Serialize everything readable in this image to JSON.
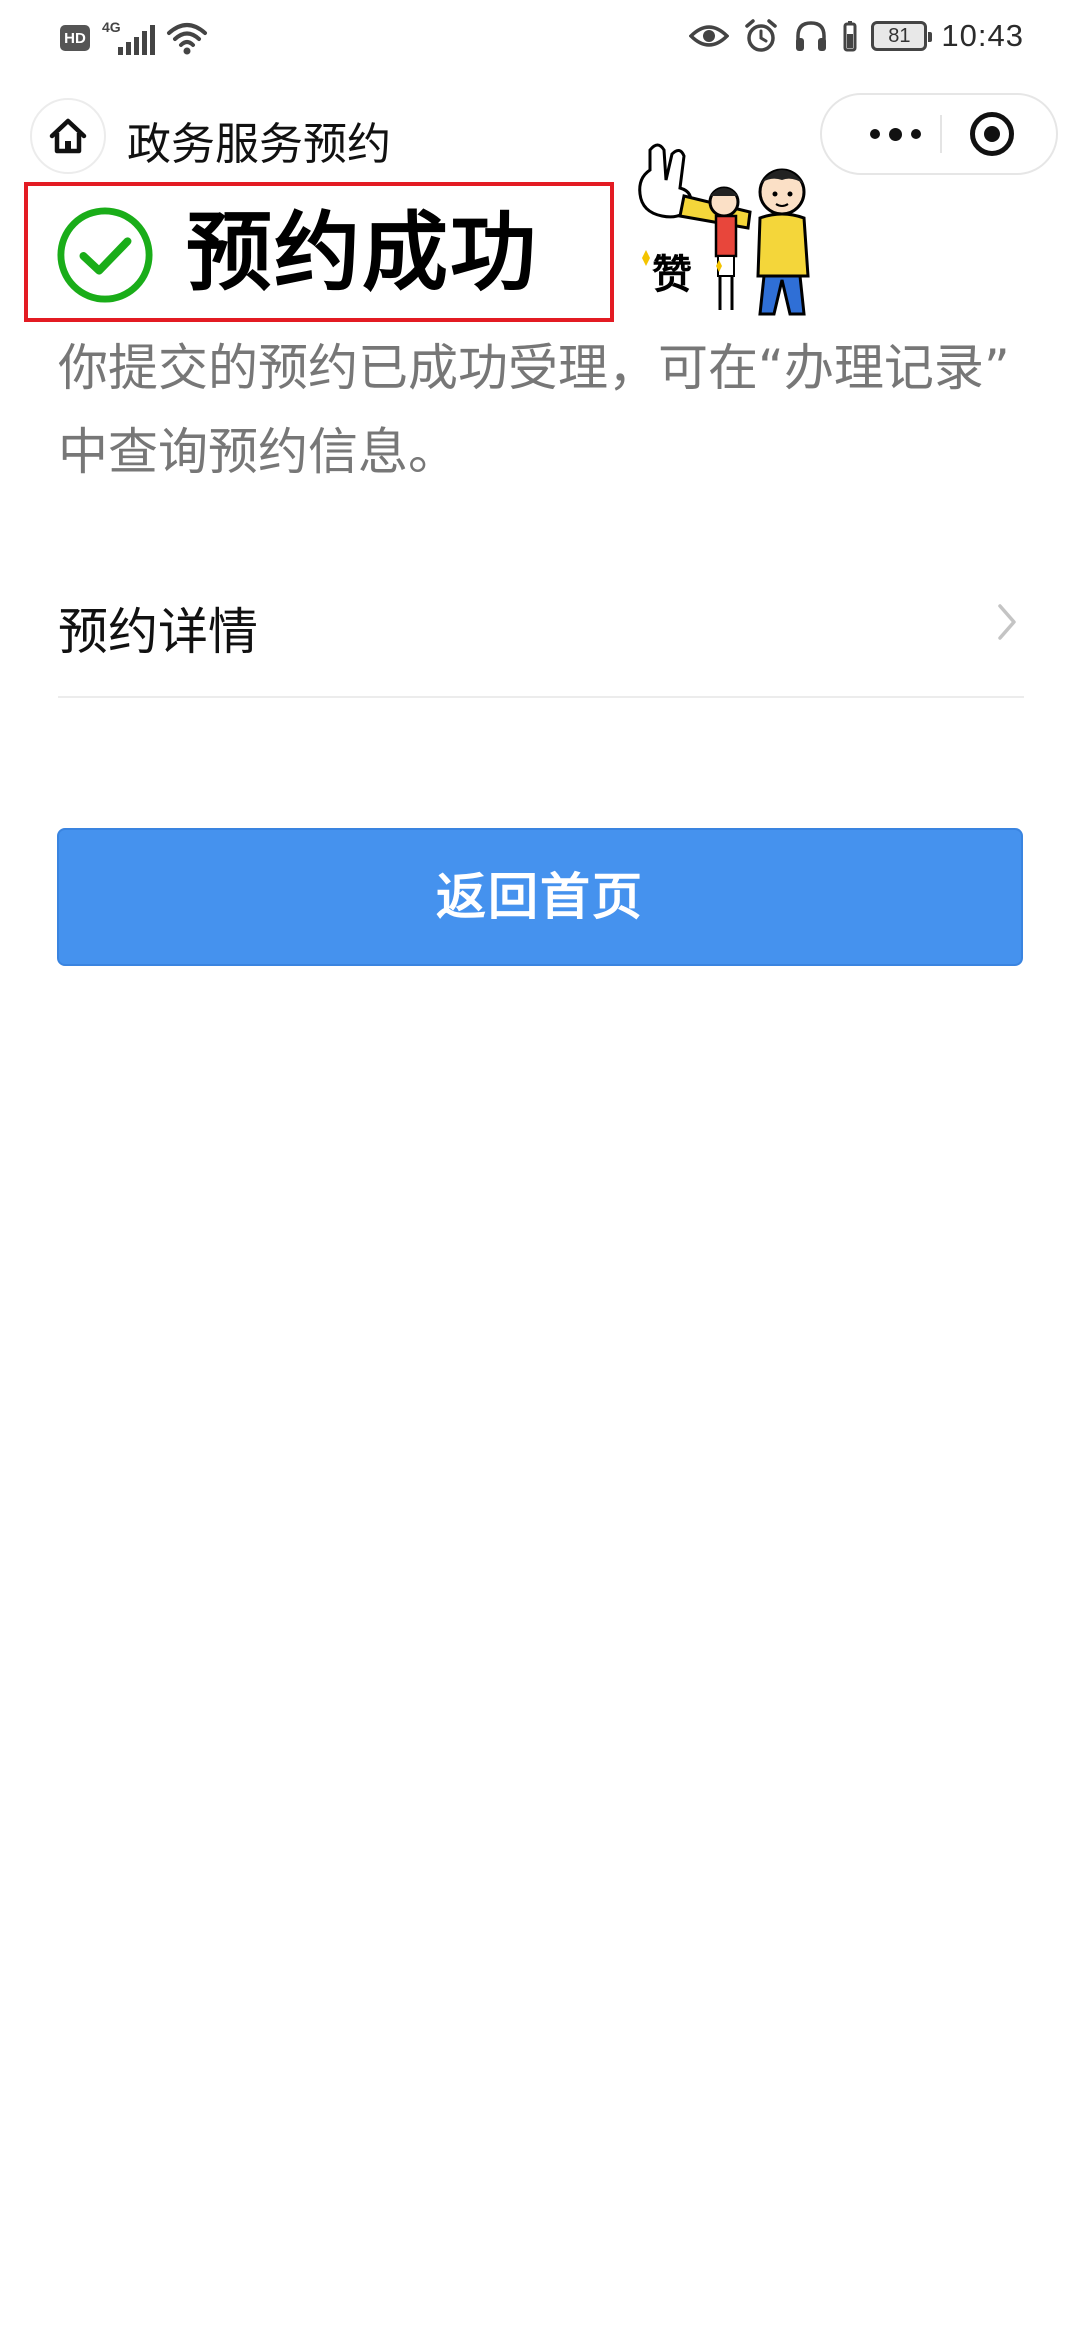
{
  "status_bar": {
    "hd_label": "HD",
    "network_label": "4G",
    "battery_level": "81",
    "time": "10:43",
    "icons": [
      "signal-icon",
      "wifi-icon",
      "eye-icon",
      "alarm-icon",
      "headphones-icon",
      "battery-icon"
    ]
  },
  "nav": {
    "title": "政务服务预约",
    "home_icon": "home-icon",
    "more_icon": "more-dots-icon",
    "close_icon": "miniprogram-close-icon"
  },
  "result": {
    "title": "预约成功",
    "icon": "success-check-icon",
    "check_color": "#1aad19",
    "highlight_color": "#e31b23"
  },
  "sticker": {
    "label": "赞",
    "icon": "thumbs-up-sticker"
  },
  "message": {
    "line1": "你提交的预约已成功受理，可在“办理记录”",
    "line2": "中查询预约信息。"
  },
  "detail": {
    "label": "预约详情",
    "icon": "chevron-right-icon"
  },
  "primary_button": {
    "label": "返回首页",
    "color": "#4592ee"
  }
}
